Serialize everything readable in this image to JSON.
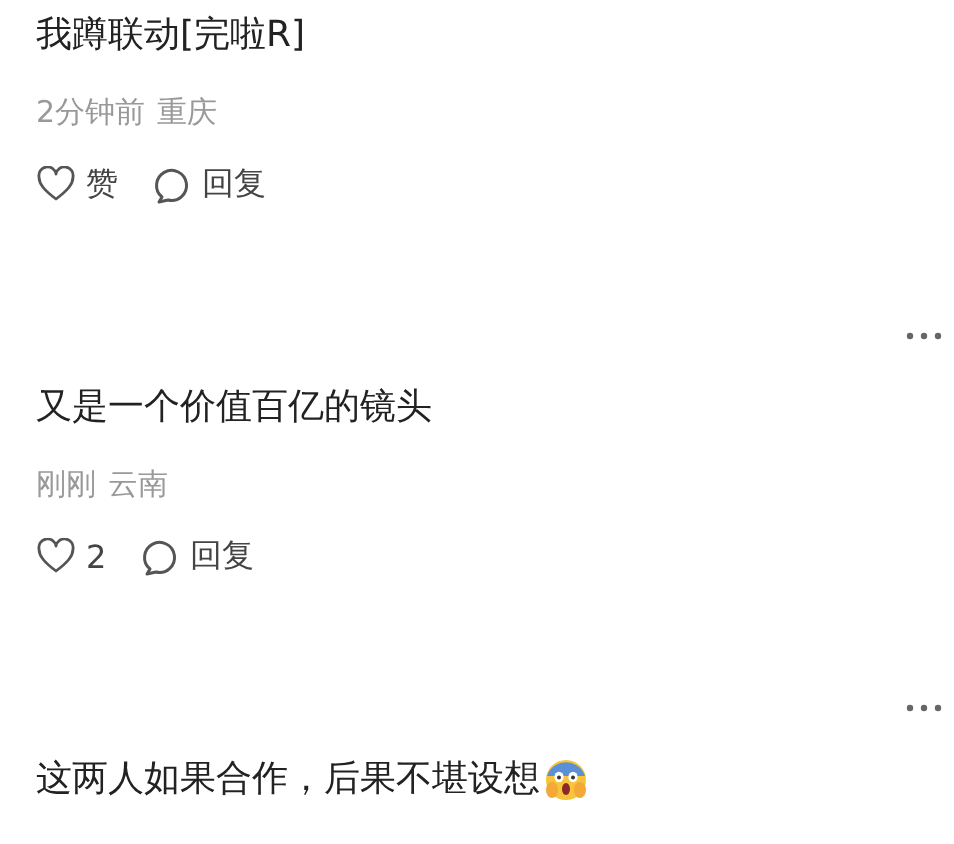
{
  "comments": [
    {
      "more": false,
      "text": "我蹲联动[完啦R]",
      "emoji": false,
      "time": "2分钟前",
      "location": "重庆",
      "like_label": "赞",
      "reply_label": "回复"
    },
    {
      "more": true,
      "text": "又是一个价值百亿的镜头",
      "emoji": false,
      "time": "刚刚",
      "location": "云南",
      "like_label": "2",
      "reply_label": "回复"
    },
    {
      "more": true,
      "text": "这两人如果合作，后果不堪设想",
      "emoji": true
    }
  ]
}
